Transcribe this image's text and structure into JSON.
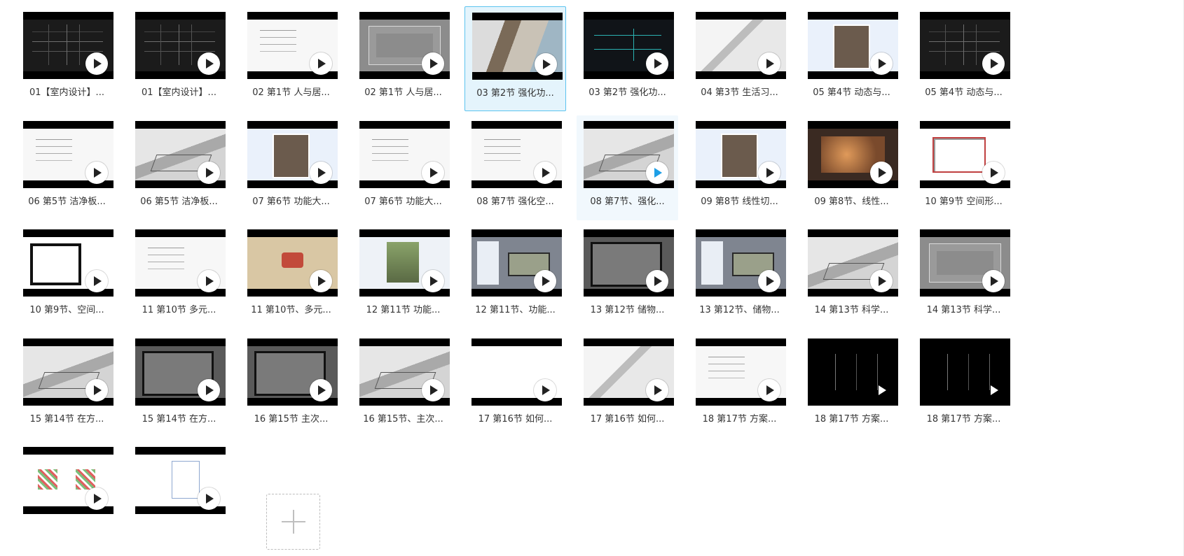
{
  "items": [
    {
      "title": "01【室内设计】...",
      "thumb": "t-dark"
    },
    {
      "title": "01【室内设计】...",
      "thumb": "t-dark"
    },
    {
      "title": "02 第1节 人与居...",
      "thumb": "t-light"
    },
    {
      "title": "02 第1节 人与居...",
      "thumb": "t-gray"
    },
    {
      "title": "03 第2节 强化功...",
      "thumb": "t-photo",
      "state": "selected"
    },
    {
      "title": "03 第2节 强化功...",
      "thumb": "t-cadcyan"
    },
    {
      "title": "04 第3节 生活习...",
      "thumb": "t-sketch"
    },
    {
      "title": "05 第4节 动态与...",
      "thumb": "t-window"
    },
    {
      "title": "05 第4节 动态与...",
      "thumb": "t-dark"
    },
    {
      "title": "06 第5节 洁净板...",
      "thumb": "t-light"
    },
    {
      "title": "06 第5节 洁净板...",
      "thumb": "t-gray3d"
    },
    {
      "title": "07 第6节 功能大...",
      "thumb": "t-window"
    },
    {
      "title": "07 第6节 功能大...",
      "thumb": "t-light"
    },
    {
      "title": "08  第7节 强化空...",
      "thumb": "t-light"
    },
    {
      "title": "08 第7节、强化...",
      "thumb": "t-gray3d",
      "state": "hover",
      "play": "active"
    },
    {
      "title": "09 第8节 线性切...",
      "thumb": "t-window"
    },
    {
      "title": "09 第8节、线性...",
      "thumb": "t-orange"
    },
    {
      "title": "10 第9节 空间形...",
      "thumb": "t-plan"
    },
    {
      "title": "10 第9节、空间...",
      "thumb": "t-box"
    },
    {
      "title": "11 第10节 多元...",
      "thumb": "t-light"
    },
    {
      "title": "11 第10节、多元...",
      "thumb": "t-beige"
    },
    {
      "title": "12 第11节 功能...",
      "thumb": "t-greenph"
    },
    {
      "title": "12 第11节、功能...",
      "thumb": "t-mixed"
    },
    {
      "title": "13 第12节 储物...",
      "thumb": "t-dim"
    },
    {
      "title": "13 第12节、储物...",
      "thumb": "t-mixed"
    },
    {
      "title": "14 第13节 科学...",
      "thumb": "t-gray3d"
    },
    {
      "title": "14 第13节 科学...",
      "thumb": "t-gray"
    },
    {
      "title": "15 第14节 在方...",
      "thumb": "t-gray3d"
    },
    {
      "title": "15 第14节 在方...",
      "thumb": "t-dim"
    },
    {
      "title": "16 第15节 主次...",
      "thumb": "t-dim"
    },
    {
      "title": "16 第15节、主次...",
      "thumb": "t-gray3d"
    },
    {
      "title": "17 第16节 如何...",
      "thumb": "t-white"
    },
    {
      "title": "17 第16节 如何...",
      "thumb": "t-sketch"
    },
    {
      "title": "18 第17节 方案...",
      "thumb": "t-light"
    },
    {
      "title": "18 第17节 方案...",
      "thumb": "t-black",
      "play": "bare"
    },
    {
      "title": "18 第17节 方案...",
      "thumb": "t-black",
      "play": "bare"
    },
    {
      "title": "",
      "thumb": "t-colorplan"
    },
    {
      "title": "",
      "thumb": "t-blueline"
    }
  ]
}
